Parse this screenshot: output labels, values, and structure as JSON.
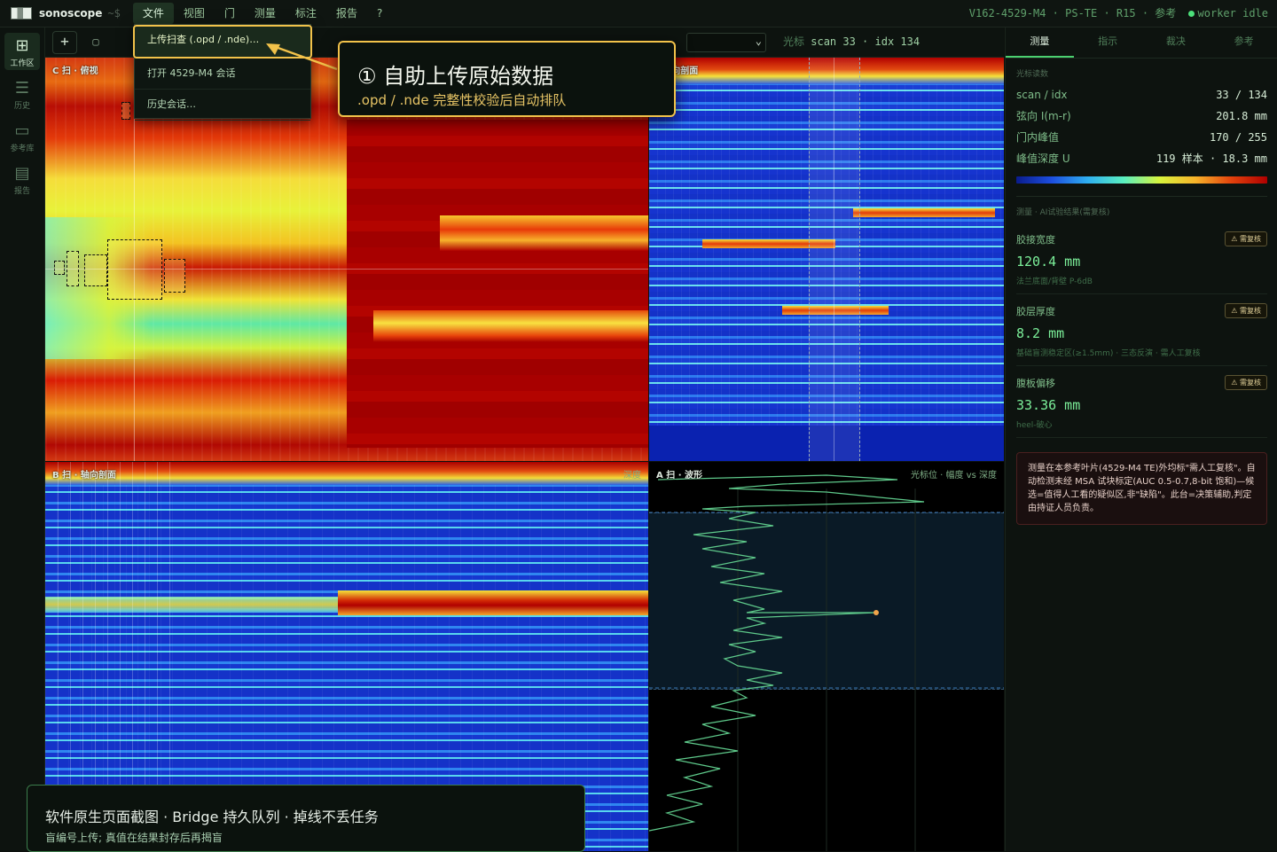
{
  "topbar": {
    "app_name": "sonoscope",
    "prompt": "~$",
    "menu": [
      "文件",
      "视图",
      "门",
      "测量",
      "标注",
      "报告",
      "?"
    ],
    "status": "V162-4529-M4 · PS-TE · R15 · 参考",
    "worker_status": "worker idle"
  },
  "leftrail": {
    "items": [
      {
        "label": "工作区",
        "icon": "grid-icon"
      },
      {
        "label": "历史",
        "icon": "list-icon"
      },
      {
        "label": "参考库",
        "icon": "book-icon"
      },
      {
        "label": "报告",
        "icon": "report-icon"
      }
    ]
  },
  "toolbar": {
    "add_icon": "plus-icon",
    "rect_icon": "square-icon",
    "cursor_label": "光标",
    "cursor_value": "scan 33 · idx 134"
  },
  "file_menu": {
    "items": [
      "上传扫查 (.opd / .nde)…",
      "打开 4529-M4 会话",
      "历史会话…"
    ]
  },
  "panels": {
    "cscan_title": "C 扫 · 俯视",
    "bxscan_title": "· 弦向剖面",
    "bscan_title": "B 扫 · 轴向剖面",
    "bscan_right": "深度",
    "ascan_title": "A 扫 · 波形",
    "ascan_right": "光标位 · 幅度 vs 深度"
  },
  "right_panel": {
    "tabs": [
      "测量",
      "指示",
      "裁决",
      "参考"
    ],
    "cursor_section": "光标读数",
    "readings": [
      {
        "k": "scan / idx",
        "v": "33 / 134"
      },
      {
        "k": "弦向 I(m-r)",
        "v": "201.8 mm"
      },
      {
        "k": "门内峰值",
        "v": "170 / 255"
      },
      {
        "k": "峰值深度 U",
        "v": "119 样本 · 18.3 mm"
      }
    ],
    "measure_section": "测量 · AI试验结果(需复核)",
    "measurements": [
      {
        "name": "胶接宽度",
        "badge": "⚠ 需复核",
        "value": "120.4 mm",
        "sub": "法兰底面/背壁 P-6dB"
      },
      {
        "name": "胶层厚度",
        "badge": "⚠ 需复核",
        "value": "8.2 mm",
        "sub": "基础盲测稳定区(≥1.5mm) · 三态反演 · 需人工复核"
      },
      {
        "name": "腹板偏移",
        "badge": "⚠ 需复核",
        "value": "33.36 mm",
        "sub": "heel-破心"
      }
    ],
    "note": "测量在本参考叶片(4529-M4 TE)外均标\"需人工复核\"。自动检测未经 MSA 试块标定(AUC 0.5-0.7,8-bit 饱和)—候选=值得人工看的疑似区,非\"缺陷\"。此台=决策辅助,判定由持证人员负责。"
  },
  "callout": {
    "title": "① 自助上传原始数据",
    "sub": ".opd / .nde 完整性校验后自动排队"
  },
  "caption": {
    "title": "软件原生页面截图 · Bridge 持久队列 · 掉线不丢任务",
    "sub": "盲编号上传; 真值在结果封存后再揭盲"
  },
  "colors": {
    "accent": "#4bd06f",
    "highlight": "#f2c24a",
    "warning_bg": "#1a0f0f"
  }
}
